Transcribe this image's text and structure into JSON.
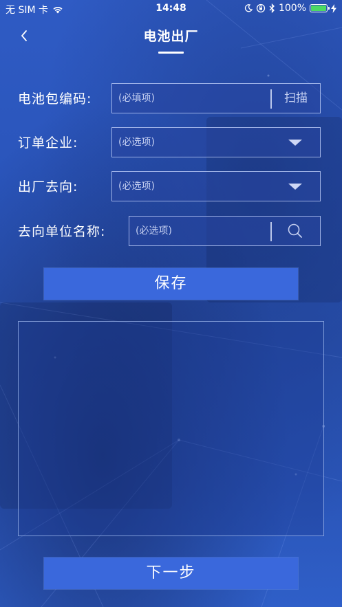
{
  "status_bar": {
    "carrier": "无 SIM 卡",
    "time": "14:48",
    "battery_percent": "100%",
    "wifi_icon": "wifi-icon",
    "battery_color": "#4cd964"
  },
  "nav": {
    "title": "电池出厂",
    "back_icon": "chevron-left-icon"
  },
  "form": {
    "battery_code": {
      "label": "电池包编码:",
      "placeholder": "(必填项)",
      "value": "",
      "scan_label": "扫描"
    },
    "order_company": {
      "label": "订单企业:",
      "placeholder": "(必选项)",
      "value": ""
    },
    "destination": {
      "label": "出厂去向:",
      "placeholder": "(必选项)",
      "value": ""
    },
    "destination_unit": {
      "label": "去向单位名称:",
      "placeholder": "(必选项)",
      "value": ""
    }
  },
  "buttons": {
    "save": "保存",
    "next": "下一步"
  },
  "colors": {
    "accent": "#3a68dc",
    "background": "#2b56bb"
  }
}
